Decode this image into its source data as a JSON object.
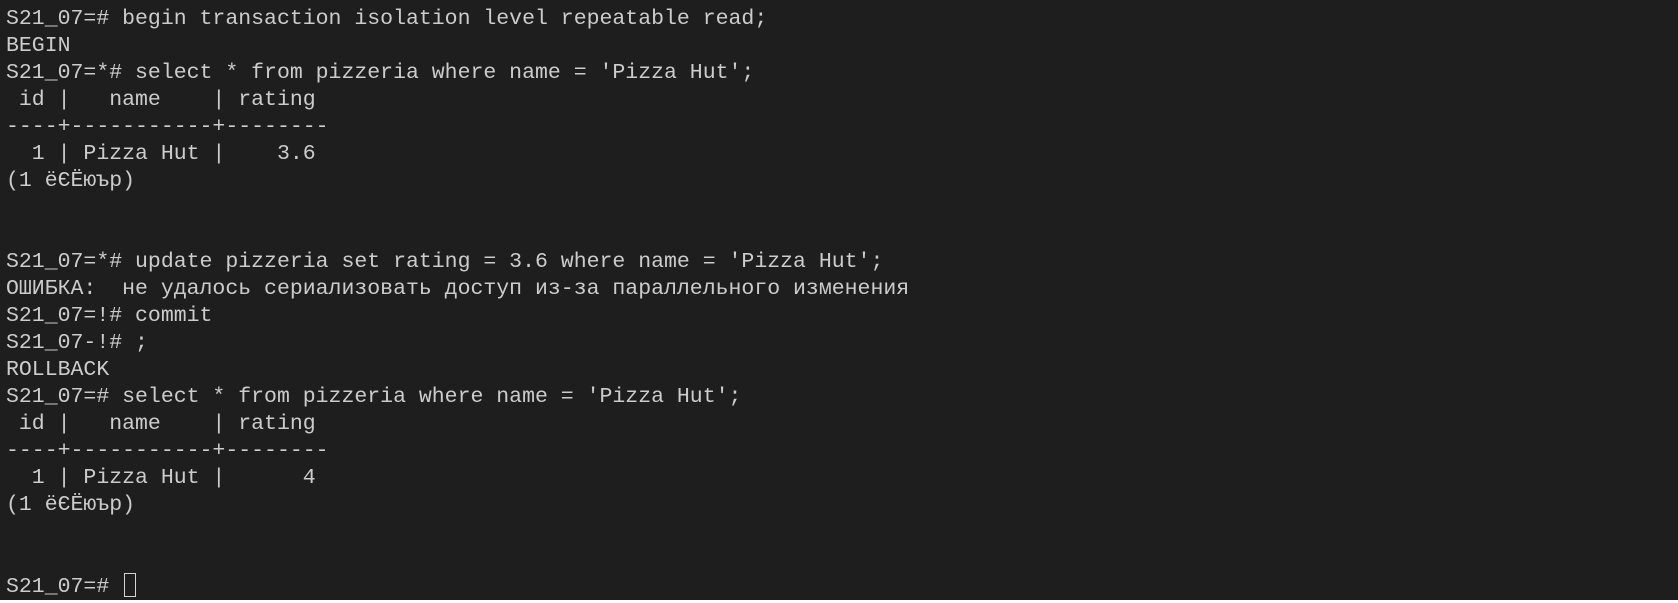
{
  "terminal": {
    "lines": [
      "S21_07=# begin transaction isolation level repeatable read;",
      "BEGIN",
      "S21_07=*# select * from pizzeria where name = 'Pizza Hut';",
      " id |   name    | rating",
      "----+-----------+--------",
      "  1 | Pizza Hut |    3.6",
      "(1 ёЄЁюър)",
      "",
      "",
      "S21_07=*# update pizzeria set rating = 3.6 where name = 'Pizza Hut';",
      "ОШИБКА:  не удалось сериализовать доступ из-за параллельного изменения",
      "S21_07=!# commit",
      "S21_07-!# ;",
      "ROLLBACK",
      "S21_07=# select * from pizzeria where name = 'Pizza Hut';",
      " id |   name    | rating",
      "----+-----------+--------",
      "  1 | Pizza Hut |      4",
      "(1 ёЄЁюър)",
      "",
      ""
    ],
    "prompt": "S21_07=# "
  }
}
